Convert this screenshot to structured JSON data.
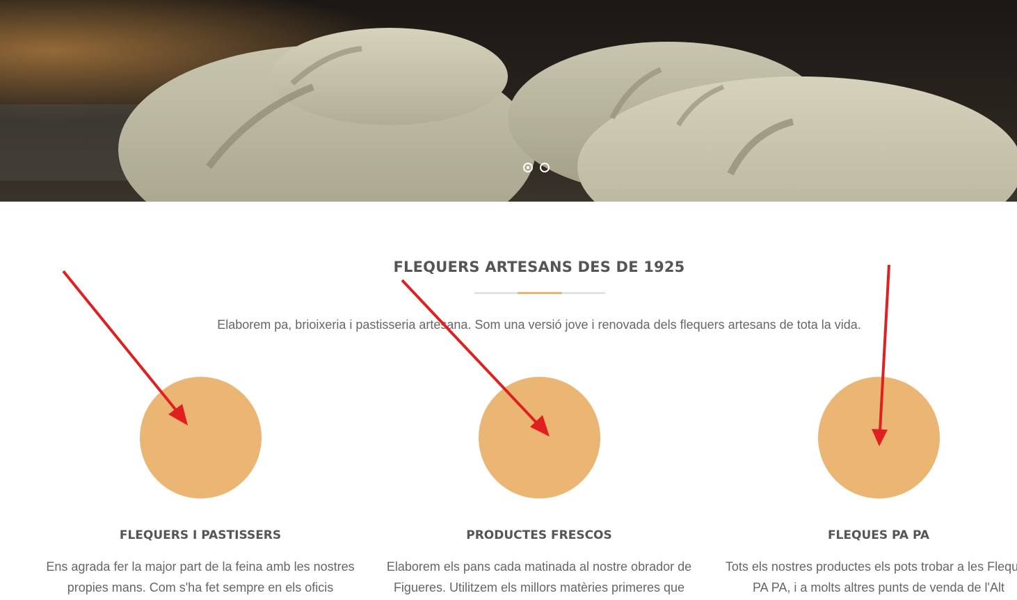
{
  "hero": {
    "slider_dots": [
      {
        "state": "active"
      },
      {
        "state": "inactive"
      }
    ]
  },
  "intro": {
    "title": "FLEQUERS ARTESANS DES DE 1925",
    "description": "Elaborem pa, brioixeria i pastisseria artesana. Som una versió jove i renovada dels flequers artesans de tota la vida."
  },
  "features": [
    {
      "title": "FLEQUERS I PASTISSERS",
      "text_line1": "Ens agrada fer la major part de la feina amb les nostres",
      "text_line2": "propies mans. Com s'ha fet sempre en els oficis"
    },
    {
      "title": "PRODUCTES FRESCOS",
      "text_line1": "Elaborem els pans cada matinada al nostre obrador de",
      "text_line2": "Figueres. Utilitzem els millors matèries primeres que"
    },
    {
      "title": "FLEQUES PA PA",
      "text_line1": "Tots els nostres productes els pots trobar a les Fleques",
      "text_line2": "PA PA, i a molts altres punts de venda de l'Alt"
    }
  ],
  "colors": {
    "accent": "#ebb574",
    "heading": "#555555",
    "body_text": "#666666",
    "annotation_arrow": "#e02020"
  }
}
